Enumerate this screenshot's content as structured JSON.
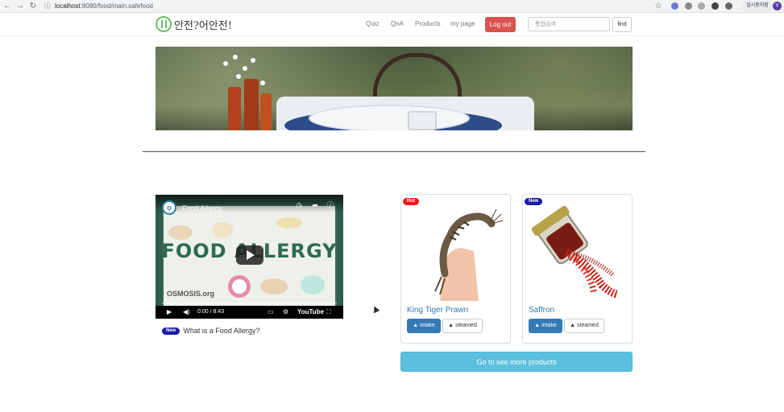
{
  "browser": {
    "url_host": "localhost",
    "url_path": ":8080/food/main.safefood",
    "paused_label": "일시중지됨",
    "profile_initial": "Y"
  },
  "header": {
    "logo_text": "안전?어안전!",
    "nav": [
      "Quiz",
      "QnA",
      "Products",
      "my page"
    ],
    "logout_label": "Log out",
    "search_placeholder": "통합검색",
    "find_label": "find"
  },
  "video": {
    "title": "Food Allergy",
    "big_title": "FOOD ALLERGY",
    "channel": "OSMOSIS.org",
    "time": "0:00 / 8:43",
    "youtube_label": "YouTube",
    "caption_badge": "New",
    "caption": "What is a Food Allergy?"
  },
  "products": [
    {
      "badge": "Hot",
      "badge_color": "#e0201c",
      "name": "King Tiger Prawn",
      "intake_label": "▲ intake",
      "steamed_label": "▲ steamed"
    },
    {
      "badge": "New",
      "badge_color": "#1a1aa6",
      "name": "Saffron",
      "intake_label": "▲ intake",
      "steamed_label": "▲ steamed"
    }
  ],
  "more_products_label": "Go to see more products",
  "colors": {
    "logout": "#d9534f",
    "primary": "#337ab7",
    "info": "#5bc0de"
  }
}
